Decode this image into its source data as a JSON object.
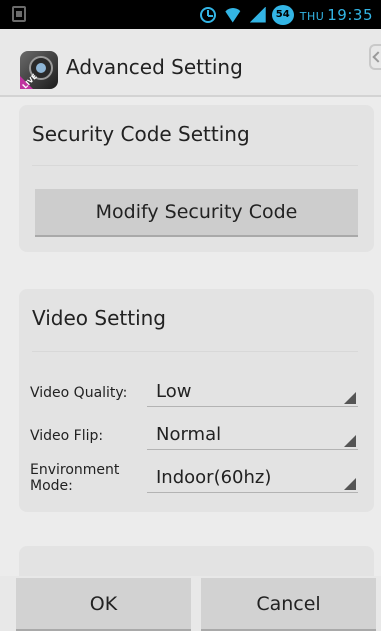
{
  "status_bar": {
    "day": "THU",
    "time": "19:35",
    "battery_level": "54",
    "colors": {
      "accent": "#33b5e5",
      "background": "#000000"
    }
  },
  "action_bar": {
    "title": "Advanced Setting",
    "logo_text": "LIVE"
  },
  "security": {
    "title": "Security Code Setting",
    "button_label": "Modify Security Code"
  },
  "video": {
    "title": "Video Setting",
    "rows": [
      {
        "label": "Video Quality:",
        "value": "Low"
      },
      {
        "label": "Video Flip:",
        "value": "Normal"
      },
      {
        "label": "Environment Mode:",
        "value": "Indoor(60hz)"
      }
    ]
  },
  "footer": {
    "ok_label": "OK",
    "cancel_label": "Cancel"
  }
}
